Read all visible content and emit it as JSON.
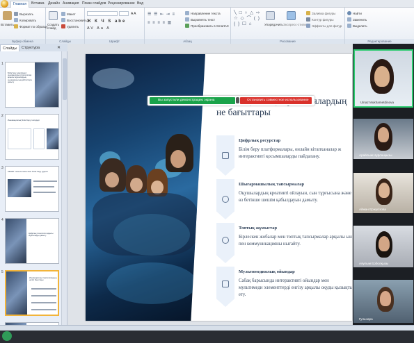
{
  "ribbon_tabs": [
    "Главная",
    "Вставка",
    "Дизайн",
    "Анимация",
    "Показ слайдов",
    "Рецензирование",
    "Вид"
  ],
  "ribbon": {
    "paste": "Вставить",
    "cut": "Вырезать",
    "copy": "Копировать",
    "format_painter": "Формат по образцу",
    "new_slide": "Создать слайд",
    "layout": "Макет",
    "reset": "Восстановить",
    "delete": "Удалить",
    "text_direction": "Направление текста",
    "align_text": "Выровнять текст",
    "convert_smartart": "Преобразовать в SmartArt",
    "arrange": "Упорядочить",
    "quick_styles": "Экспресс-стили",
    "shape_fill": "Заливка фигуры",
    "shape_outline": "Контур фигуры",
    "shape_effects": "Эффекты для фигур",
    "find": "Найти",
    "replace": "Заменить",
    "select": "Выделить",
    "groups": [
      "Буфер обмена",
      "Слайды",
      "Шрифт",
      "Абзац",
      "Рисование",
      "Редактирование"
    ]
  },
  "panel": {
    "tabs": [
      "Слайды",
      "Структура"
    ],
    "slide_numbers": [
      "1",
      "2",
      "3",
      "4",
      "5"
    ],
    "slide1_title": "Білім беру үдерісіндегі инновациялық стратегиялар арқылы оқушылардың шығармашылық қабілеттерін дамыту",
    "slide2_title": "Инновациялық білім беру тәсілдері",
    "slide3_title": "SMART технологиясы мен білім беру үдерісі",
    "slide4_title": "Цифрлық технология арқылы оқушыларды дамыту",
    "slide5_title": "Инновациялық стратегиялардың негізгі бағыттары"
  },
  "slide": {
    "title": "Инновациялық стратегиялардың не бағыттары",
    "items": [
      {
        "head": "Цифрлық ресурстар",
        "text": "Білім беру платформалары, онлайн кітапханалар ж интерактивті қосымшаларды пайдалану."
      },
      {
        "head": "Шығармашылық тапсырмалар",
        "text": "Оқушылардың креативті ойлауын, сын тұрғысына және өз бетінше шешім қабылдауын дамыту."
      },
      {
        "head": "Топтық жұмыстар",
        "text": "Бірлескен жобалар мен топтық тапсырмалар арқылы ын пен коммуникацияны нығайту."
      },
      {
        "head": "Мультимедиялық ойындар",
        "text": "Сабақ барысында интерактивті ойындар мен мультимеди элементтерді енгізу арқылы оқуды қызықты ету."
      }
    ]
  },
  "share_banner": {
    "running": "Вы запустили демонстрацию экрана",
    "stop": "Остановить совместное использование"
  },
  "participants": [
    "Ulnaz Mukhametdinova",
    "Арайлым Нурланқызы",
    "Айжан Ержусізова",
    "Аяулым Ерболқызы",
    "Гульнара"
  ],
  "colors": {
    "share_green": "#1aa34a",
    "stop_red": "#d9312b",
    "speaker_border": "#2ecc71",
    "selected_slide": "#f2b43a"
  }
}
